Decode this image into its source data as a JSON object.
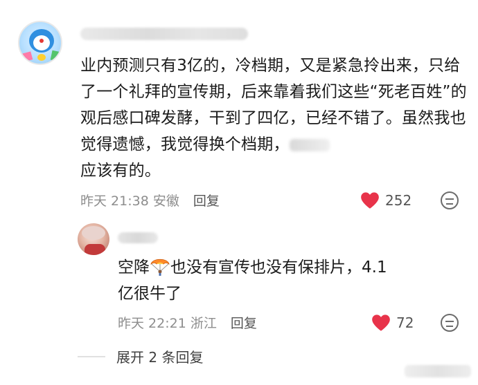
{
  "main_comment": {
    "text": "业内预测只有3亿的，冷档期，又是紧急拎出来，只给了一个礼拜的宣传期，后来靠着我们这些“死老百姓”的观后感口碑发酵，干到了四亿，已经不错了。虽然我也觉得遗憾，我觉得换个档期，",
    "text_end": "应该有的。",
    "time": "昨天 21:38",
    "location": "安徽",
    "reply_label": "回复",
    "likes": "252",
    "like_icon": "heart-icon",
    "dislike_icon": "neutral-face-icon",
    "colors": {
      "heart": "#e8334a",
      "meta": "#8d8d8d"
    }
  },
  "reply_comment": {
    "text_before_icon": "空降",
    "icon": "parachute-icon",
    "text_after_icon": "也没有宣传也没有保排片，4.1亿很牛了",
    "time": "昨天 22:21",
    "location": "浙江",
    "reply_label": "回复",
    "likes": "72"
  },
  "expand_label": "展开 2 条回复"
}
